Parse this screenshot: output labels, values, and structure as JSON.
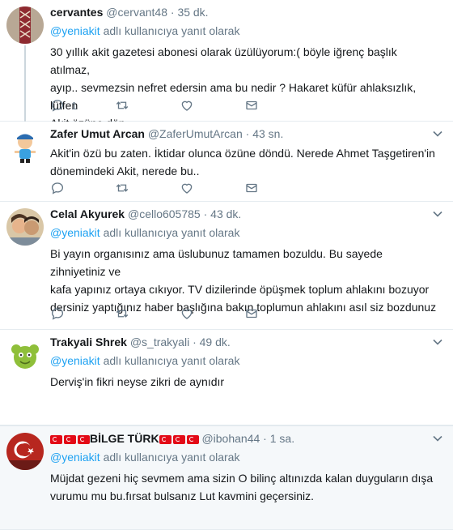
{
  "tweets": [
    {
      "name": "cervantes",
      "username": "@cervant48",
      "time": "35 dk.",
      "reply_to_prefix": "@yeniakit",
      "reply_to_suffix": " adlı kullanıcıya yanıt olarak",
      "text_lines": [
        "30 yıllık akit gazetesi abonesi olarak üzülüyorum:( böyle iğrenç başlık atılmaz,",
        "ayıp.. sevmezsin nefret edersin ama bu nedir ? Hakaret küfür ahlaksızlık, lütfen",
        "Akit özüne dön"
      ],
      "reply_count": "1",
      "retweet_count": "",
      "like_count": ""
    },
    {
      "name": "Zafer Umut Arcan",
      "username": "@ZaferUmutArcan",
      "time": "43 sn.",
      "text_lines": [
        "Akit'in özü bu zaten. İktidar olunca özüne döndü. Nerede Ahmet Taşgetiren'in",
        "dönemindeki Akit, nerede bu.."
      ],
      "reply_count": "",
      "retweet_count": "",
      "like_count": ""
    },
    {
      "name": "Celal Akyurek",
      "username": "@cello605785",
      "time": "43 dk.",
      "reply_to_prefix": "@yeniakit",
      "reply_to_suffix": " adlı kullanıcıya yanıt olarak",
      "text_lines": [
        "Bi yayın organısınız ama üslubunuz tamamen bozuldu. Bu sayede zihniyetiniz ve",
        "kafa yapınız ortaya cıkıyor. TV dizilerinde öpüşmek toplum ahlakını bozuyor",
        "dersiniz yaptığınız haber başlığına bakın toplumun ahlakını asıl siz bozdunuz"
      ],
      "reply_count": "",
      "retweet_count": "",
      "like_count": ""
    },
    {
      "name": "Trakyali Shrek",
      "username": "@s_trakyali",
      "time": "49 dk.",
      "reply_to_prefix": "@yeniakit",
      "reply_to_suffix": " adlı kullanıcıya yanıt olarak",
      "text_lines": [
        "Derviş'in fikri neyse zikri de aynıdır"
      ]
    },
    {
      "name": "BİLGE TÜRK",
      "username": "@ibohan44",
      "time": "1 sa.",
      "reply_to_prefix": "@yeniakit",
      "reply_to_suffix": " adlı kullanıcıya yanıt olarak",
      "text_lines": [
        "Müjdat gezeni hiç sevmem ama sizin O bilinç altınızda kalan duyguların dışa",
        "vurumu mu bu.fırsat bulsanız Lut kavmini geçersiniz."
      ]
    }
  ],
  "separator": "·",
  "icons": [
    "reply-icon",
    "retweet-icon",
    "like-icon",
    "dm-icon",
    "chevron-down-icon"
  ],
  "colors": {
    "link": "#1da1f2",
    "muted": "#657786",
    "text": "#14171a",
    "flag": "#e30a17"
  }
}
